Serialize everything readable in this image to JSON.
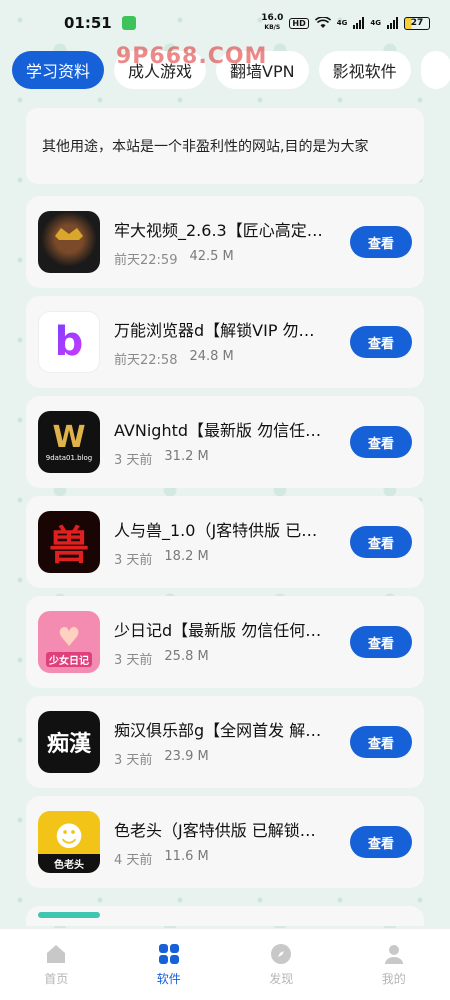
{
  "status_bar": {
    "time": "01:51",
    "net_speed_value": "16.0",
    "net_speed_unit": "KB/S",
    "hd": "HD",
    "network1": "4G",
    "network2": "4G",
    "battery": "27"
  },
  "watermark": "9P668.COM",
  "tabs": [
    {
      "label": "学习资料",
      "active": true
    },
    {
      "label": "成人游戏",
      "active": false
    },
    {
      "label": "翻墙VPN",
      "active": false
    },
    {
      "label": "影视软件",
      "active": false
    }
  ],
  "notice": "其他用途，本站是一个非盈利性的网站,目的是为大家",
  "view_label": "查看",
  "items": [
    {
      "title": "牢大视频_2.6.3【匠心高定…",
      "time": "前天22:59",
      "size": "42.5 M",
      "icon_text": ""
    },
    {
      "title": "万能浏览器d【解锁VIP 勿…",
      "time": "前天22:58",
      "size": "24.8 M",
      "icon_text": "b"
    },
    {
      "title": "AVNightd【最新版 勿信任…",
      "time": "3 天前",
      "size": "31.2 M",
      "icon_text": "9data01.blog"
    },
    {
      "title": "人与兽_1.0（J客特供版 已…",
      "time": "3 天前",
      "size": "18.2 M",
      "icon_text": "兽"
    },
    {
      "title": "少日记d【最新版 勿信任何…",
      "time": "3 天前",
      "size": "25.8 M",
      "icon_text": "少女日记"
    },
    {
      "title": "痴汉俱乐部g【全网首发 解…",
      "time": "3 天前",
      "size": "23.9 M",
      "icon_text": "痴漢"
    },
    {
      "title": "色老头（J客特供版 已解锁…",
      "time": "4 天前",
      "size": "11.6 M",
      "icon_text": "色老头"
    }
  ],
  "nav": [
    {
      "label": "首页",
      "icon": "home-icon",
      "active": false
    },
    {
      "label": "软件",
      "icon": "grid-icon",
      "active": true
    },
    {
      "label": "发现",
      "icon": "compass-icon",
      "active": false
    },
    {
      "label": "我的",
      "icon": "user-icon",
      "active": false
    }
  ],
  "colors": {
    "accent": "#1660d8",
    "card": "#f7f7f7",
    "background": "#e8f2ef"
  }
}
